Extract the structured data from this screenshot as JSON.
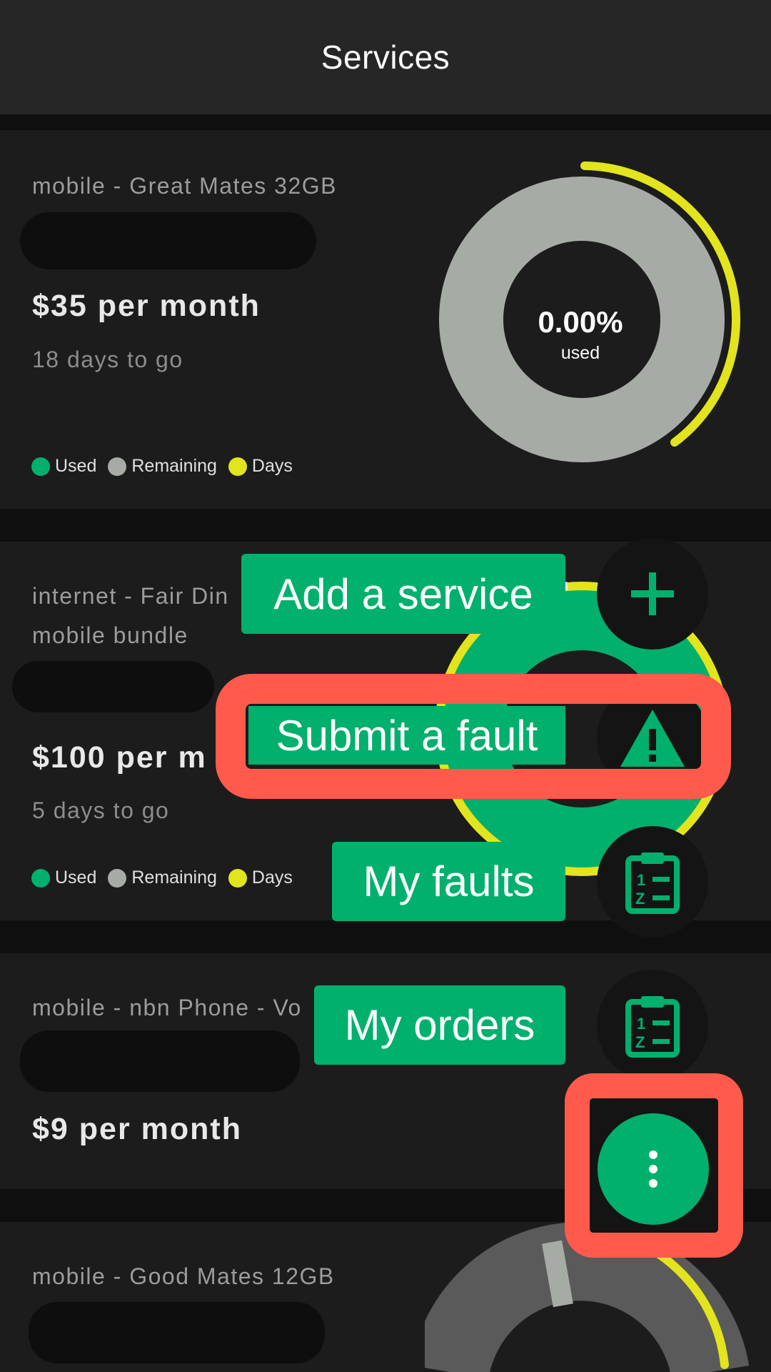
{
  "header": {
    "title": "Services"
  },
  "cards": [
    {
      "type_label": "mobile - Great Mates 32GB",
      "price": "$35 per month",
      "days_left": "18 days to go",
      "usage": {
        "percent_text": "0.00%",
        "sub_label": "used",
        "used_fraction": 0.0,
        "days_fraction": 0.4
      }
    },
    {
      "type_label": "internet - Fair Din",
      "type_label_line2": "mobile bundle",
      "price": "$100 per m",
      "days_left": "5 days to go"
    },
    {
      "type_label": "mobile - nbn Phone - Vo",
      "price": "$9 per month"
    },
    {
      "type_label": "mobile - Good Mates 12GB"
    }
  ],
  "legend": {
    "used": "Used",
    "remaining": "Remaining",
    "days": "Days"
  },
  "fab_menu": {
    "add_service": "Add a service",
    "submit_fault": "Submit a fault",
    "my_faults": "My faults",
    "my_orders": "My orders"
  },
  "colors": {
    "used": "#00b06c",
    "remaining": "#a6aca5",
    "days": "#e2e41e",
    "highlight": "#ff5a4b",
    "accent": "#00b06c"
  },
  "icons": {
    "add": "plus-icon",
    "fault": "warning-icon",
    "faults": "clipboard-list-icon",
    "orders": "clipboard-list-icon",
    "menu": "more-vertical-icon"
  }
}
